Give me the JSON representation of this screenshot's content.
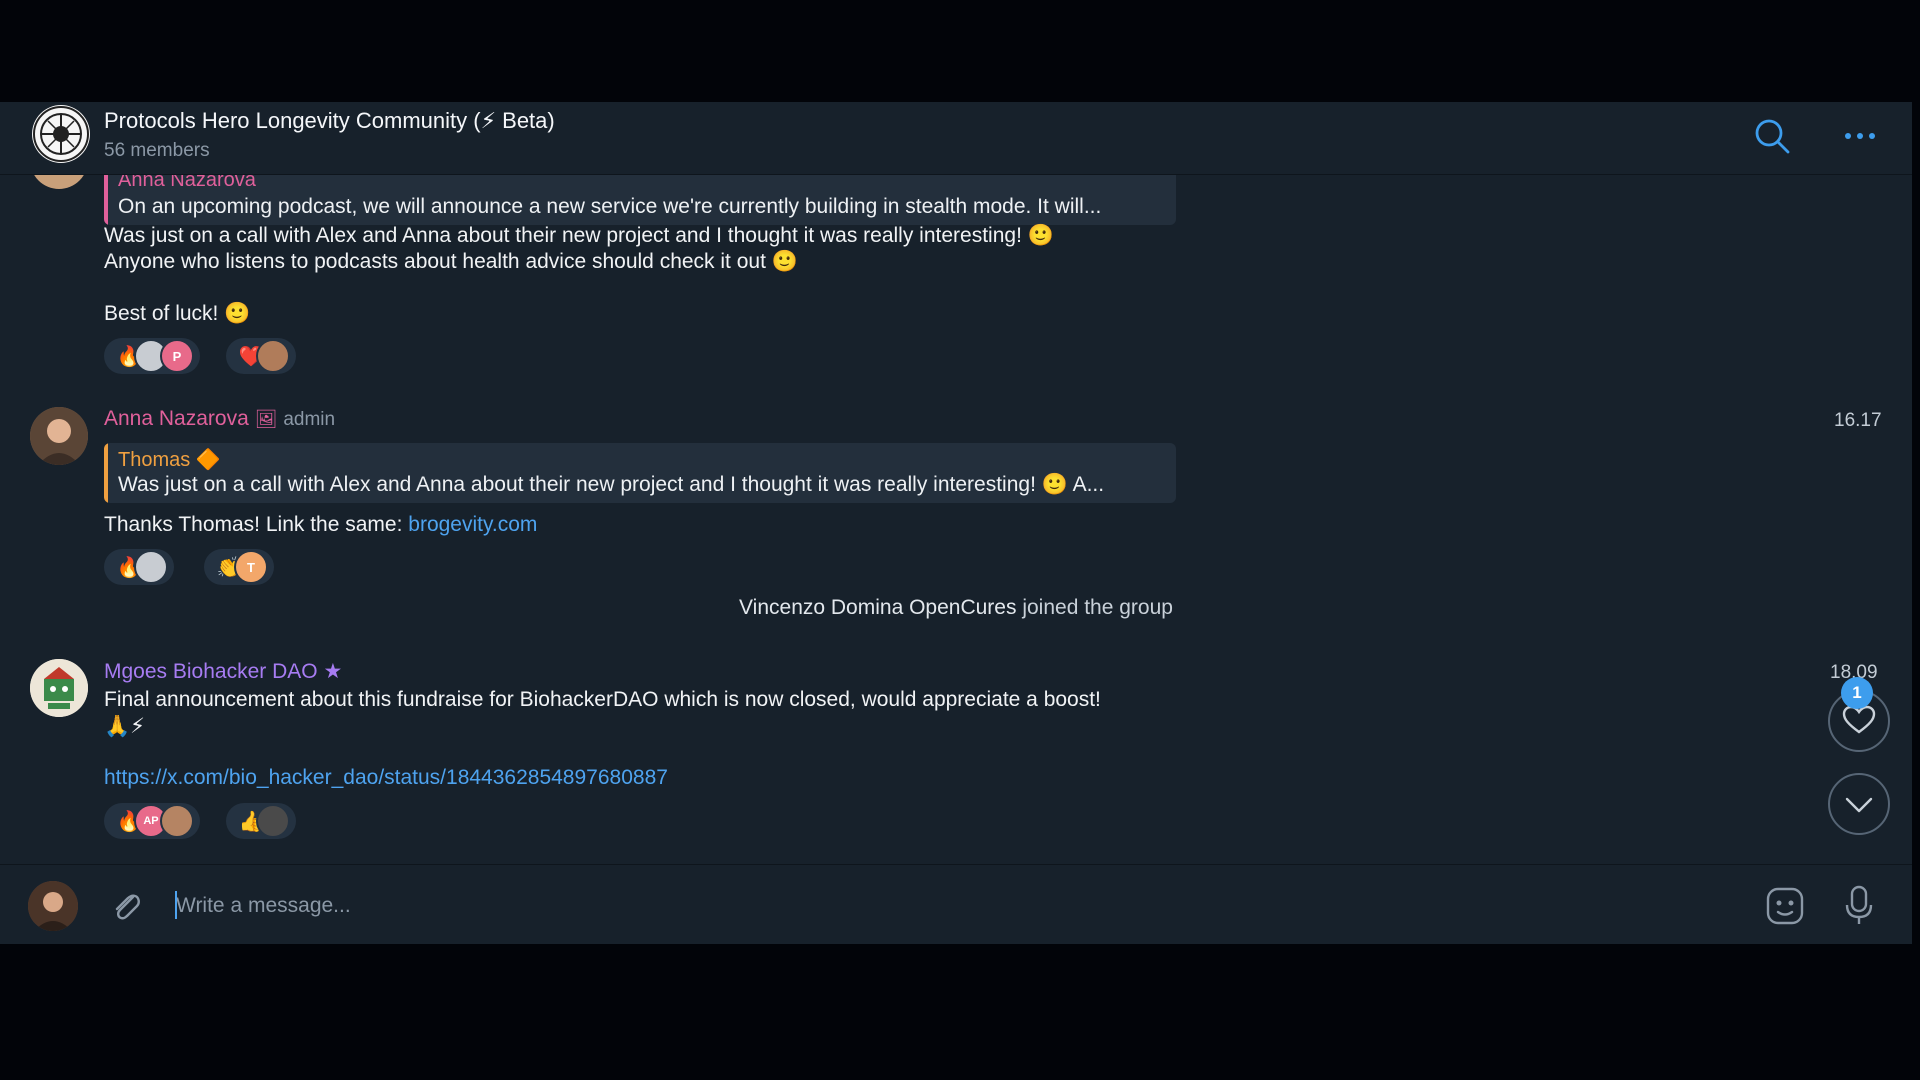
{
  "header": {
    "title": "Protocols Hero Longevity Community (⚡ Beta)",
    "members": "56 members",
    "icons": [
      "search-icon",
      "more-icon"
    ]
  },
  "messages": {
    "first": {
      "quote_name": "Anna Nazarova",
      "quote_text": "On an upcoming podcast, we will announce a new service we're currently building in stealth mode.  It will...",
      "line1": "Was just on a call with Alex and Anna about their new project and I thought it was really interesting! 🙂",
      "line2": "Anyone who listens to podcasts about health advice should check it out 🙂",
      "line3": "Best of luck! 🙂",
      "reactions": [
        {
          "emoji": "🔥",
          "avatar_letter": "P"
        },
        {
          "emoji": "❤️"
        }
      ]
    },
    "second": {
      "author": "Anna Nazarova",
      "role": "admin",
      "time": "16.17",
      "quote_name": "Thomas 🔶",
      "quote_text": "Was just on a call with Alex and Anna about their new project and I thought it was really interesting! 🙂  A...",
      "text_prefix": "Thanks Thomas! Link the same: ",
      "link": "brogevity.com",
      "reactions": [
        {
          "emoji": "🔥"
        },
        {
          "emoji": "👏",
          "avatar_letter": "T"
        }
      ]
    },
    "service": {
      "name": "Vincenzo Domina OpenCures",
      "action": " joined the group"
    },
    "third": {
      "author": "Mgoes Biohacker DAO",
      "time": "18.09",
      "line1": "Final announcement about this fundraise for BiohackerDAO which is now closed, would appreciate a boost!",
      "line2": "🙏⚡",
      "link": "https://x.com/bio_hacker_dao/status/1844362854897680887",
      "reactions": [
        {
          "emoji": "🔥",
          "avatar_letter": "AP"
        },
        {
          "emoji": "👍"
        }
      ]
    }
  },
  "fabs": {
    "unread_reactions": "1"
  },
  "composer": {
    "placeholder": "Write a message..."
  },
  "colors": {
    "background": "#17212b",
    "accent": "#4ea3ef",
    "name_pink": "#e0609b",
    "name_orange": "#f0a040",
    "name_purple": "#a77cf2"
  }
}
